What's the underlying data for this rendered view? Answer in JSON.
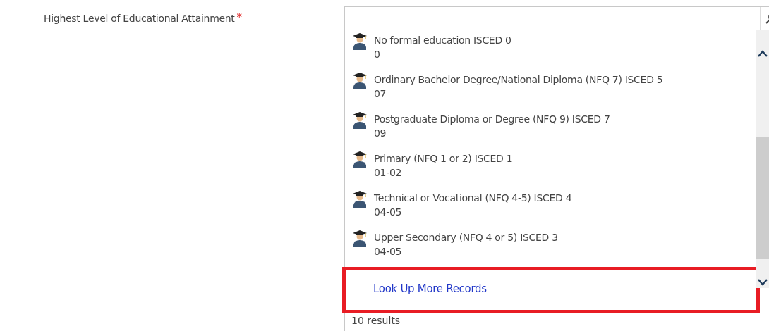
{
  "field": {
    "label": "Highest Level of Educational Attainment",
    "required_mark": "*"
  },
  "results": [
    {
      "name": "No formal education ISCED 0",
      "code": "0"
    },
    {
      "name": "Ordinary Bachelor Degree/National Diploma (NFQ 7) ISCED 5",
      "code": "07"
    },
    {
      "name": "Postgraduate Diploma or Degree (NFQ 9) ISCED 7",
      "code": "09"
    },
    {
      "name": "Primary (NFQ 1 or 2) ISCED 1",
      "code": "01-02"
    },
    {
      "name": "Technical or Vocational (NFQ 4-5) ISCED 4",
      "code": "04-05"
    },
    {
      "name": "Upper Secondary (NFQ 4 or 5) ISCED 3",
      "code": "04-05"
    }
  ],
  "look_up_link": "Look Up More Records",
  "result_count": "10 results"
}
